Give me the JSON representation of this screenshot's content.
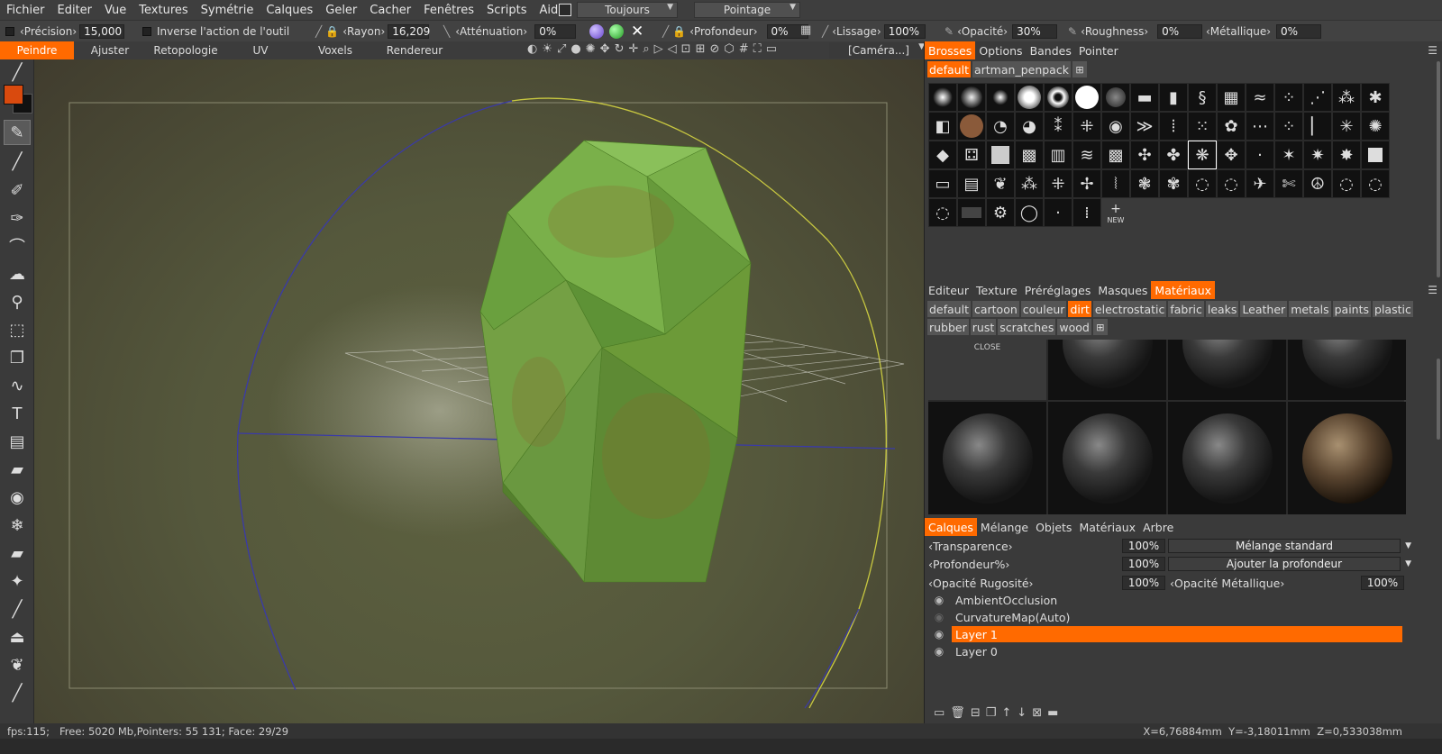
{
  "menu": {
    "items": [
      "Fichier",
      "Editer",
      "Vue",
      "Textures",
      "Symétrie",
      "Calques",
      "Geler",
      "Cacher",
      "Fenêtres",
      "Scripts",
      "Aide"
    ],
    "stroke_mode": "Toujours",
    "pointing_mode": "Pointage"
  },
  "tool_options": {
    "precision_label": "‹Précision›",
    "precision_value": "15,000",
    "invert_label": "Inverse l'action de l'outil",
    "radius_label": "‹Rayon›",
    "radius_value": "16,209",
    "falloff_label": "‹Atténuation›",
    "falloff_value": "0%",
    "depth_label": "‹Profondeur›",
    "depth_value": "0%",
    "smoothing_label": "‹Lissage›",
    "smoothing_value": "100%",
    "opacity_label": "‹Opacité›",
    "opacity_value": "30%",
    "roughness_label": "‹Roughness›",
    "roughness_value": "0%",
    "metallic_label": "‹Métallique›",
    "metallic_value": "0%"
  },
  "rooms": {
    "items": [
      "Peindre",
      "Ajuster",
      "Retopologie",
      "UV",
      "Voxels",
      "Rendereur"
    ],
    "active": "Peindre",
    "camera": "[Caméra...]"
  },
  "brush_panel": {
    "tabs": [
      "Brosses",
      "Options",
      "Bandes",
      "Pointer"
    ],
    "active_tab": "Brosses",
    "packs": [
      "default",
      "artman_penpack"
    ],
    "active_pack": "default",
    "new_label": "NEW"
  },
  "material_panel": {
    "tabs": [
      "Editeur",
      "Texture",
      "Préréglages",
      "Masques",
      "Matériaux"
    ],
    "active_tab": "Matériaux",
    "categories": [
      "default",
      "cartoon",
      "couleur",
      "dirt",
      "electrostatic",
      "fabric",
      "leaks",
      "Leather",
      "metals",
      "paints",
      "plastic",
      "rubber",
      "rust",
      "scratches",
      "wood"
    ],
    "active_category": "dirt",
    "close_label": "CLOSE"
  },
  "layers_panel": {
    "tabs": [
      "Calques",
      "Mélange",
      "Objets",
      "Matériaux",
      "Arbre"
    ],
    "active_tab": "Calques",
    "transparency_label": "‹Transparence›",
    "transparency_value": "100%",
    "blend_mode": "Mélange standard",
    "depth_label": "‹Profondeur%›",
    "depth_value": "100%",
    "depth_mode": "Ajouter la profondeur",
    "rough_opacity_label": "‹Opacité Rugosité›",
    "rough_opacity_value": "100%",
    "metal_opacity_label": "‹Opacité Métallique›",
    "metal_opacity_value": "100%",
    "layers": [
      {
        "name": "AmbientOcclusion",
        "active": false
      },
      {
        "name": "CurvatureMap(Auto)",
        "active": false
      },
      {
        "name": "Layer 1",
        "active": true
      },
      {
        "name": "Layer 0",
        "active": false
      }
    ]
  },
  "status": {
    "left": "fps:115;   Free: 5020 Mb,Pointers: 55 131; Face: 29/29",
    "right": "X=6,76884mm  Y=-3,18011mm  Z=0,533038mm"
  },
  "colors": {
    "accent": "#ff6a00",
    "primary_color": "#d94a0e",
    "secondary_color": "#111111"
  }
}
